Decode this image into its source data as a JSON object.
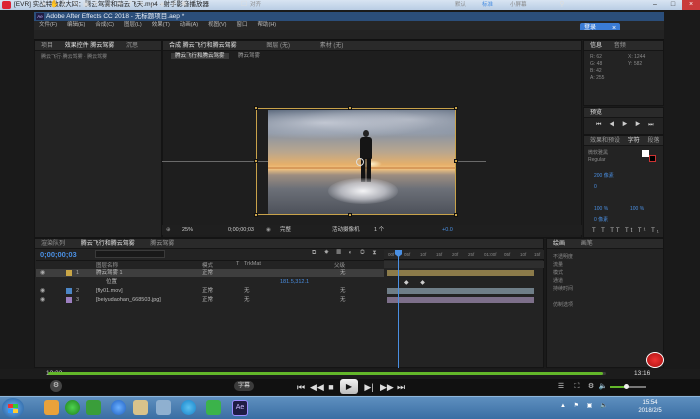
{
  "player": {
    "title": "[EVR] 实战特效教大四：腾云驾雾和踏云飞天.mp4 - 射手影音播放器",
    "time_current": "12:22",
    "time_total": "13:16",
    "progress_fraction": 0.995,
    "caption_btn": "字幕"
  },
  "ae": {
    "title": "Adobe After Effects CC 2018 - 无标题项目.aep *",
    "badge": "Ae",
    "menu": [
      "文件(F)",
      "编辑(E)",
      "合成(C)",
      "图层(L)",
      "效果(T)",
      "动画(A)",
      "视图(V)",
      "窗口",
      "帮助(H)"
    ],
    "toolbar_right": [
      "默认",
      "标准",
      "小屏幕"
    ],
    "snap_label": "对齐"
  },
  "notification": {
    "text": "登录"
  },
  "project_panel": {
    "tabs": [
      "项目",
      "效果控件 腾云驾雾",
      "沉思"
    ],
    "tab_active_index": 1,
    "subtitle": "腾云飞行·腾云驾雾 · 腾云驾雾"
  },
  "viewer": {
    "tabs": [
      "合成 腾云飞行和腾云驾雾",
      "图层 (无)",
      "素材 (无)"
    ],
    "subtabs": [
      "腾云飞行和腾云驾雾",
      "腾云驾雾"
    ],
    "zoom": "25%",
    "timecode": "0;00;00;03",
    "quality": "完整",
    "camera": "活动摄像机",
    "views": "1 个",
    "offset": "+0.0"
  },
  "right_panels": {
    "info_tab": "信息",
    "audio_tab": "音频",
    "info_lines": [
      "R: 62",
      "G: 48",
      "B: 42",
      "A: 255"
    ],
    "info_coords": [
      "X: 1244",
      "Y: 582"
    ],
    "preview_tab": "预览",
    "effects_tab": "效果和预设",
    "char_tab": "字符",
    "para_tab": "段落",
    "char_lines": [
      "微软雅黑",
      "Regular",
      "200 像素",
      "0",
      "100 %",
      "100 %",
      "0 像素"
    ]
  },
  "timeline": {
    "tabs": [
      "渲染队列",
      "腾云飞行和腾云驾雾",
      "腾云驾雾"
    ],
    "tab_active_index": 1,
    "time": "0;00;00;03",
    "columns": [
      "图层名称",
      "模式",
      "T",
      "TrkMat",
      "父级"
    ],
    "layers": [
      {
        "num": "1",
        "name": "腾云驾雾 1",
        "mode": "正常",
        "trk": "",
        "parent": "无",
        "color": "#c9a646",
        "selected": true
      },
      {
        "num": "",
        "name": "位置",
        "mode": "",
        "trk": "",
        "parent": "",
        "value": "181.5,312.1",
        "color": "",
        "selected": false
      },
      {
        "num": "2",
        "name": "[fly01.mov]",
        "mode": "正常",
        "trk": "无",
        "parent": "无",
        "color": "#4c86c6",
        "selected": false
      },
      {
        "num": "3",
        "name": "[beiyudaohan_668503.jpg]",
        "mode": "正常",
        "trk": "无",
        "parent": "无",
        "color": "#9c7fc0",
        "selected": false
      }
    ],
    "ruler_marks": [
      "00f",
      "05f",
      "10f",
      "15f",
      "20f",
      "25f",
      "01:00f",
      "05f",
      "10f",
      "15f"
    ]
  },
  "bottom_right": {
    "tabs": [
      "绘画",
      "画笔"
    ],
    "lines": [
      "不透明度",
      "流量",
      "模式",
      "通道",
      "持续时间",
      "仿制选项"
    ]
  },
  "taskbar": {
    "clock_time": "15:54",
    "clock_date": "2018/2/5"
  },
  "colors": {
    "accent": "#4a8fe2",
    "progress": "#63b72a",
    "bbox": "#c8a24a"
  }
}
